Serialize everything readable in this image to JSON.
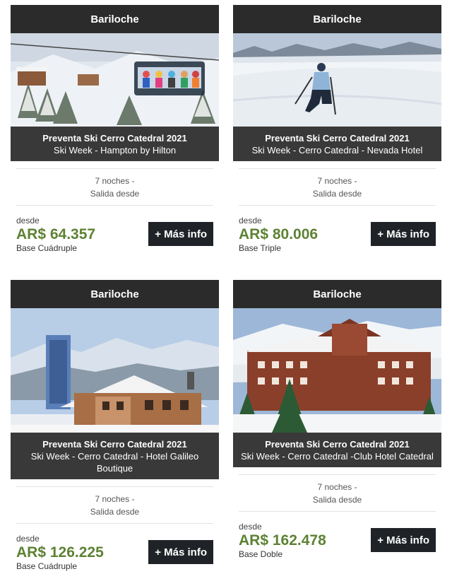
{
  "cards": [
    {
      "destination": "Bariloche",
      "title": "Preventa Ski Cerro Catedral 2021",
      "subtitle": "Ski Week - Hampton by Hilton",
      "nights": "7 noches -",
      "departure": "Salida desde",
      "from_label": "desde",
      "price": "AR$ 64.357",
      "base": "Base Cuádruple",
      "button": "+ Más info",
      "image_icon": "ski-lift-chair-photo"
    },
    {
      "destination": "Bariloche",
      "title": "Preventa Ski Cerro Catedral 2021",
      "subtitle": "Ski Week - Cerro Catedral - Nevada Hotel",
      "nights": "7 noches -",
      "departure": "Salida desde",
      "from_label": "desde",
      "price": "AR$ 80.006",
      "base": "Base Triple",
      "button": "+ Más info",
      "image_icon": "skier-slope-photo"
    },
    {
      "destination": "Bariloche",
      "title": "Preventa Ski Cerro Catedral 2021",
      "subtitle": "Ski Week - Cerro Catedral - Hotel Galileo Boutique",
      "nights": "7 noches -",
      "departure": "Salida desde",
      "from_label": "desde",
      "price": "AR$ 126.225",
      "base": "Base Cuádruple",
      "button": "+ Más info",
      "image_icon": "hotel-building-photo"
    },
    {
      "destination": "Bariloche",
      "title": "Preventa Ski Cerro Catedral 2021",
      "subtitle": "Ski Week - Cerro Catedral -Club Hotel Catedral",
      "nights": "7 noches -",
      "departure": "Salida desde",
      "from_label": "desde",
      "price": "AR$ 162.478",
      "base": "Base Doble",
      "button": "+ Más info",
      "image_icon": "snow-hotel-photo"
    }
  ],
  "colors": {
    "header_bg": "#2b2b2b",
    "caption_bg": "#3a3939",
    "price_green": "#5d8233",
    "button_bg": "#1f2328"
  }
}
